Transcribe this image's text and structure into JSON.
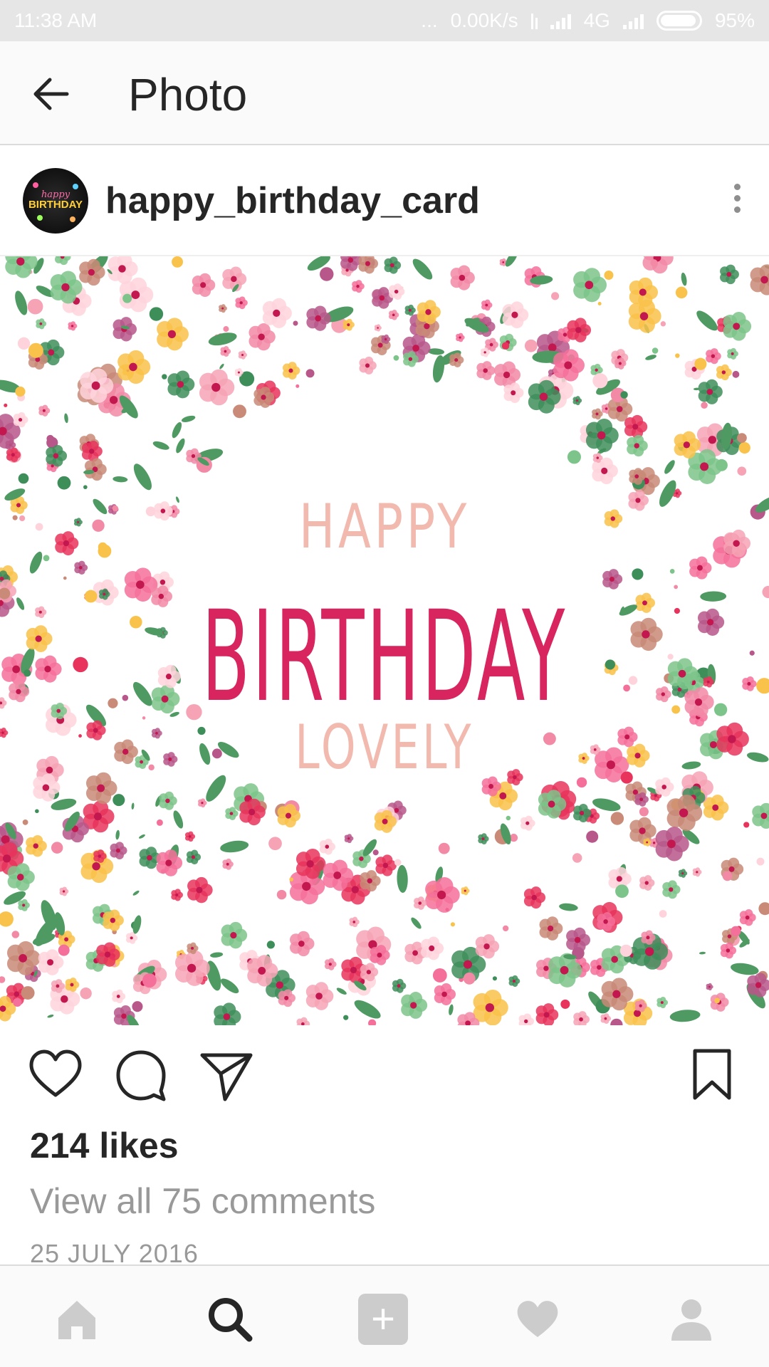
{
  "status_bar": {
    "time": "11:38 AM",
    "dots": "...",
    "network_speed": "0.00K/s",
    "network_type": "4G",
    "battery": "95%",
    "battery_level": 0.95
  },
  "app_bar": {
    "back_icon": "arrow-left",
    "title": "Photo"
  },
  "post": {
    "username": "happy_birthday_card",
    "avatar": {
      "line1": "happy",
      "line2": "BIRTHDAY"
    },
    "more_icon": "vertical-ellipsis",
    "image": {
      "text_top": "HAPPY",
      "text_main": "BIRTHDAY",
      "text_bottom": "LOVELY",
      "colors": {
        "main": "#d8245f",
        "soft": "#f2b9ae",
        "flower_palette": [
          "#e8345c",
          "#f28aa6",
          "#f9c24a",
          "#b7578a",
          "#f6a3b5",
          "#c98a77",
          "#3e8e5a",
          "#7cc48a",
          "#f4709a",
          "#ffd3dc"
        ]
      }
    },
    "actions": {
      "like_icon": "heart-outline",
      "comment_icon": "comment-bubble",
      "share_icon": "paper-plane",
      "save_icon": "bookmark"
    },
    "likes": "214 likes",
    "view_comments": "View all 75 comments",
    "date": "25 JULY 2016"
  },
  "bottom_nav": {
    "items": [
      "home",
      "search",
      "add",
      "activity",
      "profile"
    ],
    "selected": "search",
    "add_symbol": "+"
  },
  "colors": {
    "text": "#262626",
    "muted": "#999999",
    "divider": "#dbdbdb",
    "inactive_nav": "#cccccc"
  }
}
